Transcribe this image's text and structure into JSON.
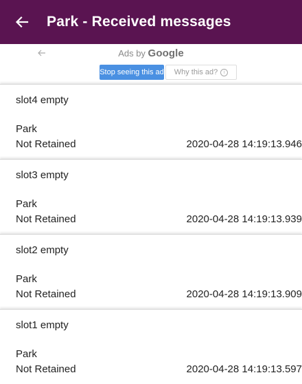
{
  "appbar": {
    "title": "Park - Received messages",
    "background": "#5a1451"
  },
  "ad": {
    "label_prefix": "Ads by ",
    "label_brand": "Google",
    "stop_label": "Stop seeing this ad",
    "why_label": "Why this ad?",
    "why_icon_glyph": "i",
    "stop_color": "#4a90e2"
  },
  "messages": [
    {
      "topic": "slot4 empty",
      "payload": "Park",
      "retained": "Not Retained",
      "timestamp": "2020-04-28 14:19:13.946"
    },
    {
      "topic": "slot3 empty",
      "payload": "Park",
      "retained": "Not Retained",
      "timestamp": "2020-04-28 14:19:13.939"
    },
    {
      "topic": "slot2 empty",
      "payload": "Park",
      "retained": "Not Retained",
      "timestamp": "2020-04-28 14:19:13.909"
    },
    {
      "topic": "slot1 empty",
      "payload": "Park",
      "retained": "Not Retained",
      "timestamp": "2020-04-28 14:19:13.597"
    }
  ],
  "icons": {
    "appbar_back": "arrow-back-icon",
    "ad_back": "arrow-back-icon",
    "why_info": "info-icon"
  }
}
